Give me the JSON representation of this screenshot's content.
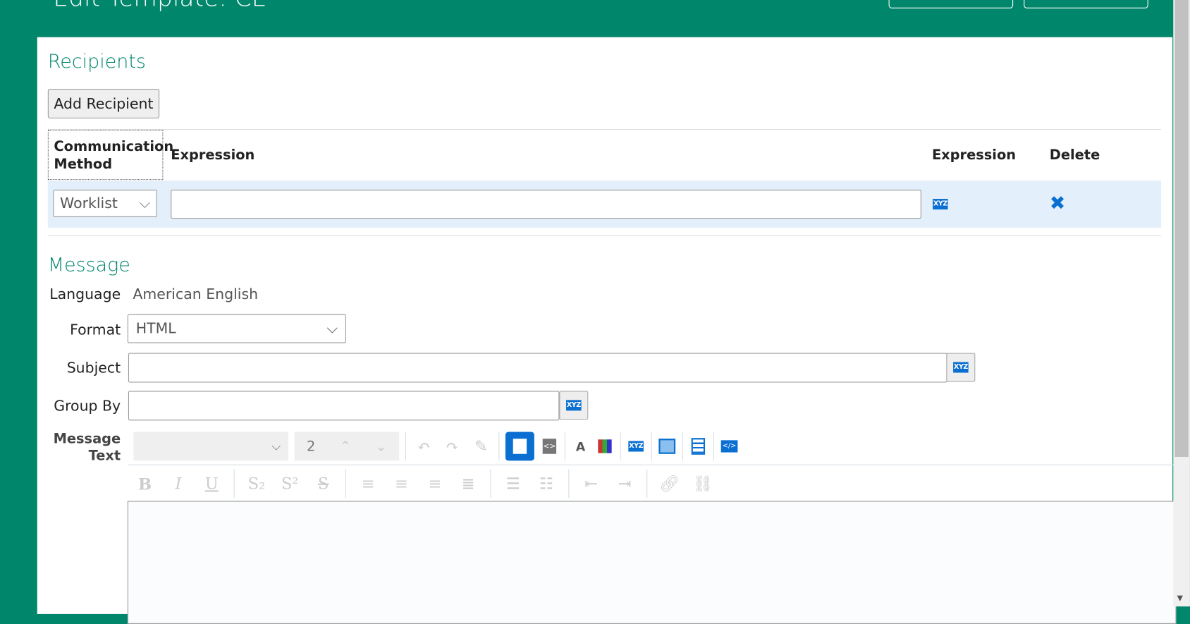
{
  "header": {
    "title": "Edit Template: CE",
    "buttons": [
      "",
      ""
    ]
  },
  "recipients": {
    "heading": "Recipients",
    "add_button": "Add Recipient",
    "columns": [
      "Communication Method",
      "Expression",
      "Expression",
      "Delete"
    ],
    "rows": [
      {
        "method": "Worklist",
        "expression": "",
        "expression_icon": "XYZ",
        "delete_icon": "✖"
      }
    ]
  },
  "message": {
    "heading": "Message",
    "language_label": "Language",
    "language_value": "American English",
    "format_label": "Format",
    "format_value": "HTML",
    "subject_label": "Subject",
    "subject_value": "",
    "groupby_label": "Group By",
    "groupby_value": "",
    "text_label": "Message Text",
    "font_size": "2",
    "xyz": "XYZ",
    "toolbar2": [
      "B",
      "I",
      "U",
      "S₂",
      "S²",
      "S"
    ]
  },
  "colors": {
    "brand": "#00866a",
    "accent": "#0a6fd1",
    "row_highlight": "#e3f0fc"
  }
}
